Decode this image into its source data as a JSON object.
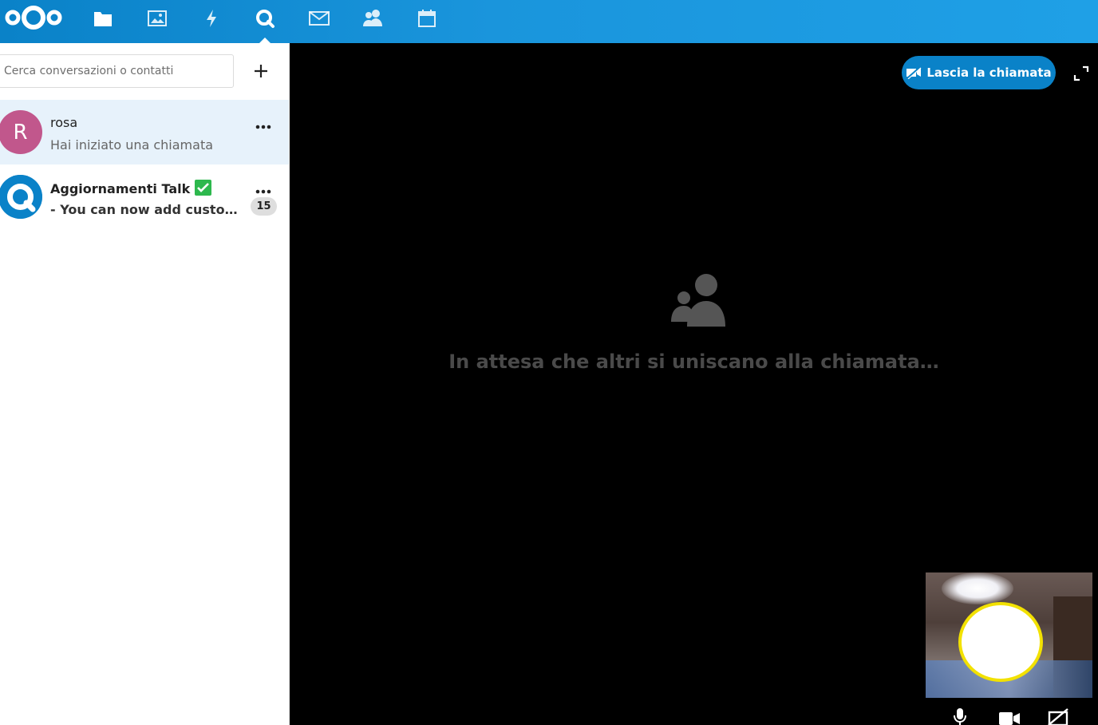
{
  "header": {
    "apps": [
      {
        "name": "files-icon"
      },
      {
        "name": "photos-icon"
      },
      {
        "name": "activity-icon"
      },
      {
        "name": "talk-icon",
        "active": true
      },
      {
        "name": "mail-icon"
      },
      {
        "name": "contacts-icon"
      },
      {
        "name": "calendar-icon"
      }
    ]
  },
  "sidebar": {
    "search": {
      "placeholder": "Cerca conversazioni o contatti",
      "value": ""
    },
    "conversations": [
      {
        "avatar_letter": "R",
        "avatar_color": "#c1578c",
        "name": "rosa",
        "subtitle": "Hai iniziato una chiamata",
        "active": true
      },
      {
        "name": "Aggiornamenti Talk",
        "subtitle": "- You can now add custom user groups to Talk",
        "unread": "15",
        "avatar_color": "#0a82c8"
      }
    ]
  },
  "call": {
    "leave_label": "Lascia la chiamata",
    "waiting_text": "In attesa che altri si uniscano alla chiamata…"
  },
  "colors": {
    "accent": "#0a82c8",
    "highlight": "#f2e100"
  }
}
